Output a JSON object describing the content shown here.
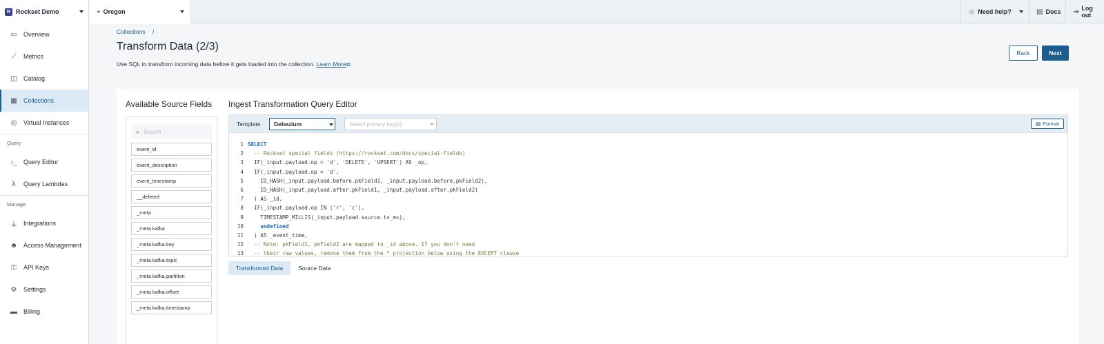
{
  "org": {
    "logo_letter": "R",
    "name": "Rockset Demo"
  },
  "region": {
    "name": "Oregon"
  },
  "top_right": {
    "help": "Need help?",
    "docs": "Docs",
    "logout": "Log out"
  },
  "sidebar": {
    "items": [
      {
        "label": "Overview"
      },
      {
        "label": "Metrics"
      },
      {
        "label": "Catalog"
      },
      {
        "label": "Collections"
      },
      {
        "label": "Virtual Instances"
      }
    ],
    "section_query": "Query",
    "query_items": [
      {
        "label": "Query Editor"
      },
      {
        "label": "Query Lambdas"
      }
    ],
    "section_manage": "Manage",
    "manage_items": [
      {
        "label": "Integrations"
      },
      {
        "label": "Access Management"
      },
      {
        "label": "API Keys"
      },
      {
        "label": "Settings"
      },
      {
        "label": "Billing"
      }
    ]
  },
  "header": {
    "breadcrumb": "Collections",
    "breadcrumb_sep": "/",
    "title": "Transform Data (2/3)",
    "subtitle": "Use SQL to transform incoming data before it gets loaded into the collection.",
    "learn_more": "Learn More",
    "back": "Back",
    "next": "Next"
  },
  "source": {
    "title": "Available Source Fields",
    "search_placeholder": "Search",
    "fields": [
      "event_id",
      "event_description",
      "event_timestamp",
      "__deleted",
      "_meta",
      "_meta.kafka",
      "_meta.kafka.key",
      "_meta.kafka.topic",
      "_meta.kafka.partition",
      "_meta.kafka.offset",
      "_meta.kafka.timestamp"
    ]
  },
  "editor": {
    "title": "Ingest Transformation Query Editor",
    "template_label": "Template",
    "template_value": "Debezium",
    "pk_placeholder": "Select primary key(s)",
    "format": "Format",
    "lines": [
      "SELECT",
      "  -- Rockset special fields (https://rockset.com/docs/special-fields)",
      "  IF(_input.payload.op = 'd', 'DELETE', 'UPSERT') AS _op,",
      "  IF(_input.payload.op = 'd',",
      "    ID_HASH(_input.payload.before.pkField1, _input.payload.before.pkField2),",
      "    ID_HASH(_input.payload.after.pkField1, _input.payload.after.pkField2)",
      "  ) AS _id,",
      "  IF(_input.payload.op IN ('r', 'c'),",
      "    TIMESTAMP_MILLIS(_input.payload.source.ts_ms),",
      "    undefined",
      "  ) AS _event_time,",
      "  -- Note: pkField1, pkField2 are mapped to _id above. If you don't need",
      "  -- their raw values, remove them from the * projection below using the EXCEPT clause"
    ],
    "tabs": [
      "Transformed Data",
      "Source Data"
    ]
  }
}
